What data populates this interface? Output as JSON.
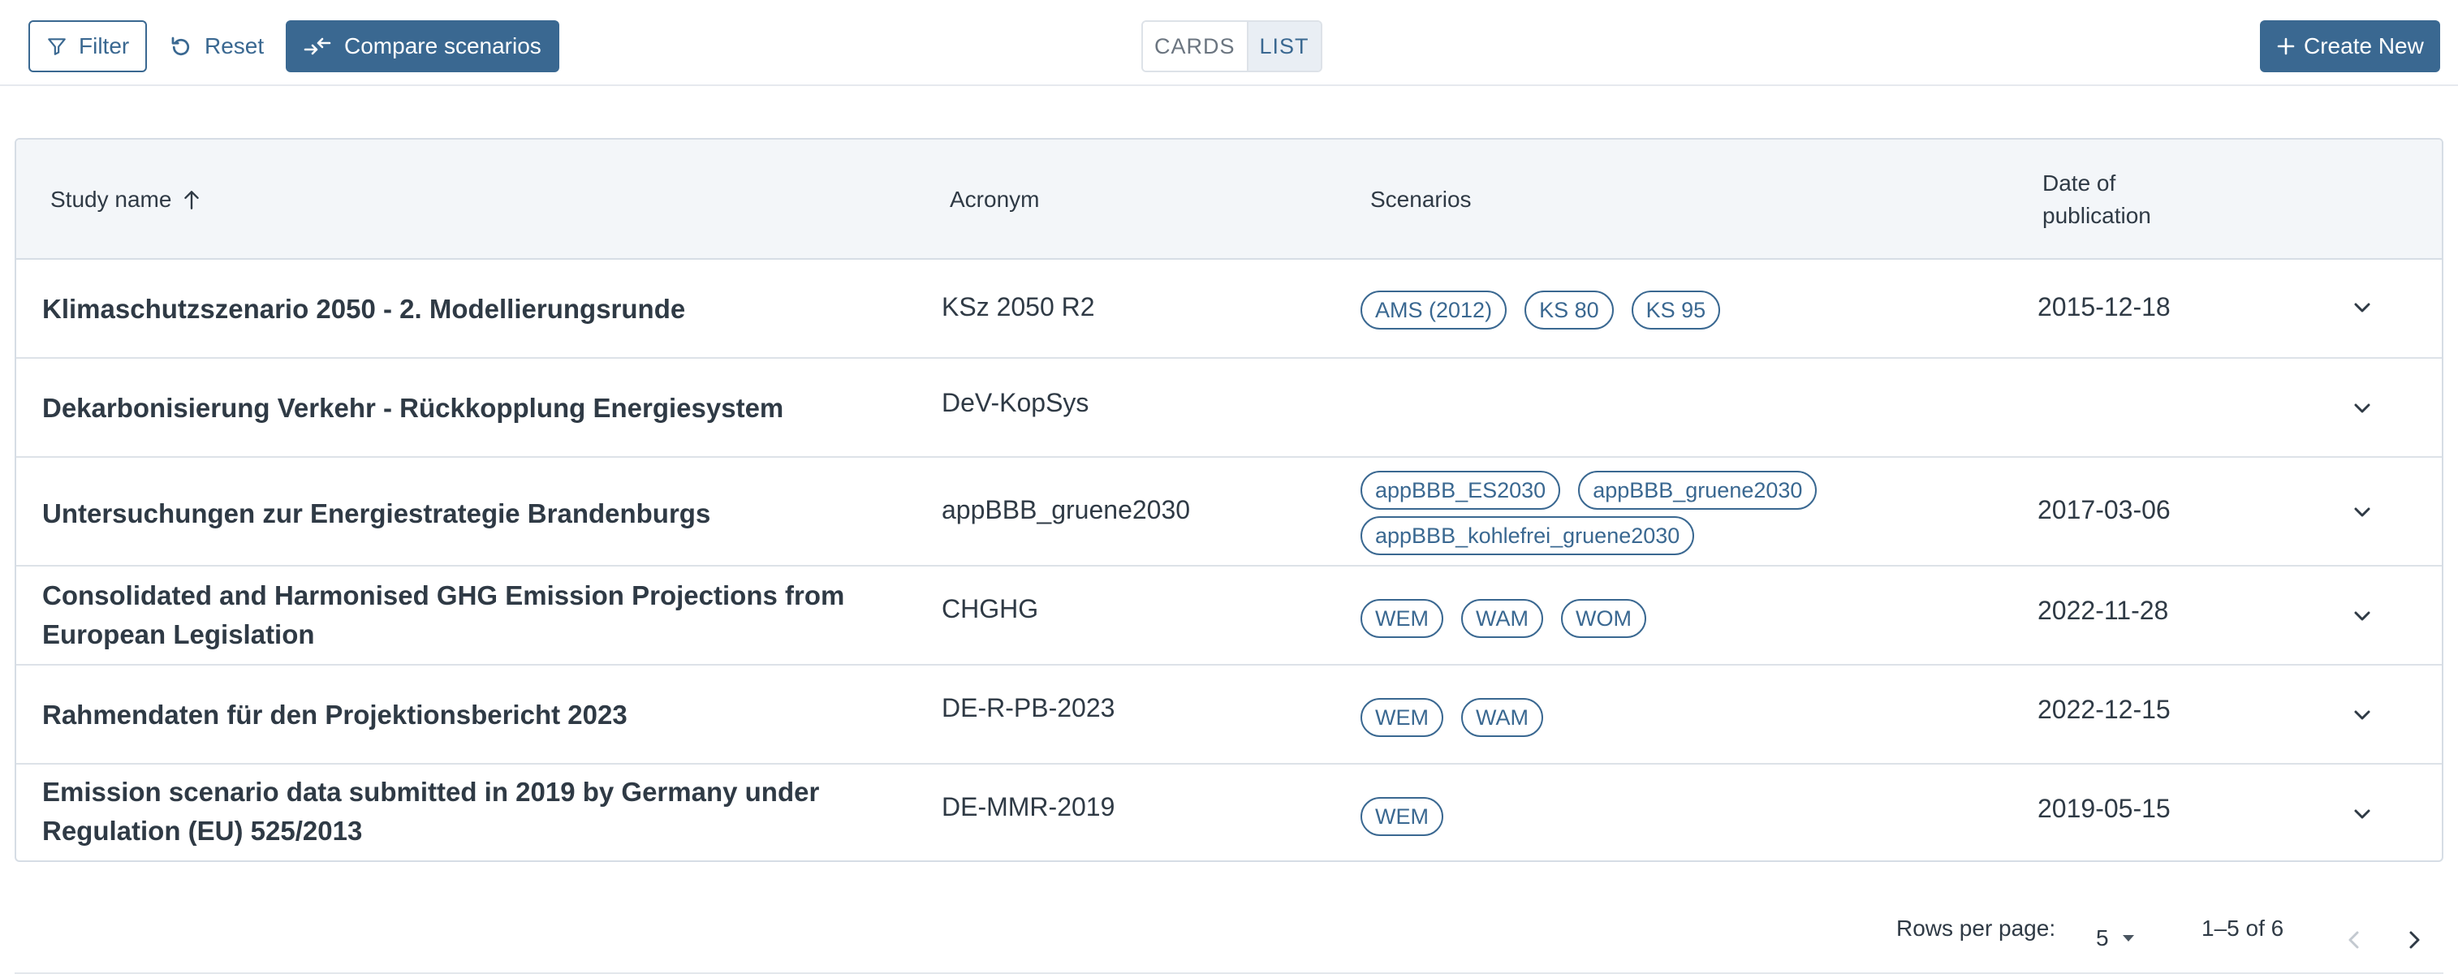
{
  "toolbar": {
    "filter_label": "Filter",
    "reset_label": "Reset",
    "compare_label": "Compare scenarios",
    "view_toggle": {
      "cards": "CARDS",
      "list": "LIST",
      "selected": "LIST"
    },
    "create_label": "Create New"
  },
  "table": {
    "columns": {
      "study_name": "Study name",
      "acronym": "Acronym",
      "scenarios": "Scenarios",
      "date_line1": "Date of",
      "date_line2": "publication"
    },
    "sort": {
      "column": "Study name",
      "direction": "ascending"
    },
    "rows": [
      {
        "name": "Klimaschutzszenario 2050 - 2. Modellierungsrunde",
        "acronym": "KSz 2050 R2",
        "scenarios": [
          "AMS (2012)",
          "KS 80",
          "KS 95"
        ],
        "date": "2015-12-18"
      },
      {
        "name": "Dekarbonisierung Verkehr - Rückkopplung Energiesystem",
        "acronym": "DeV-KopSys",
        "scenarios": [],
        "date": ""
      },
      {
        "name": "Untersuchungen zur Energiestrategie Brandenburgs",
        "acronym": "appBBB_gruene2030",
        "scenarios": [
          "appBBB_ES2030",
          "appBBB_gruene2030",
          "appBBB_kohlefrei_gruene2030"
        ],
        "date": "2017-03-06"
      },
      {
        "name": "Consolidated and Harmonised GHG Emission Projections from European Legislation",
        "acronym": "CHGHG",
        "scenarios": [
          "WEM",
          "WAM",
          "WOM"
        ],
        "date": "2022-11-28"
      },
      {
        "name": "Rahmendaten für den Projektionsbericht 2023",
        "acronym": "DE-R-PB-2023",
        "scenarios": [
          "WEM",
          "WAM"
        ],
        "date": "2022-12-15"
      },
      {
        "name": "Emission scenario data submitted in 2019 by Germany under Regulation (EU) 525/2013",
        "acronym": "DE-MMR-2019",
        "scenarios": [
          "WEM"
        ],
        "date": "2019-05-15"
      }
    ]
  },
  "pagination": {
    "rows_per_page_label": "Rows per page:",
    "rows_per_page": "5",
    "range": "1–5 of 6"
  },
  "colors": {
    "accent": "#3a6891",
    "header_bg": "#f3f6f9",
    "border": "#d6dde5"
  }
}
